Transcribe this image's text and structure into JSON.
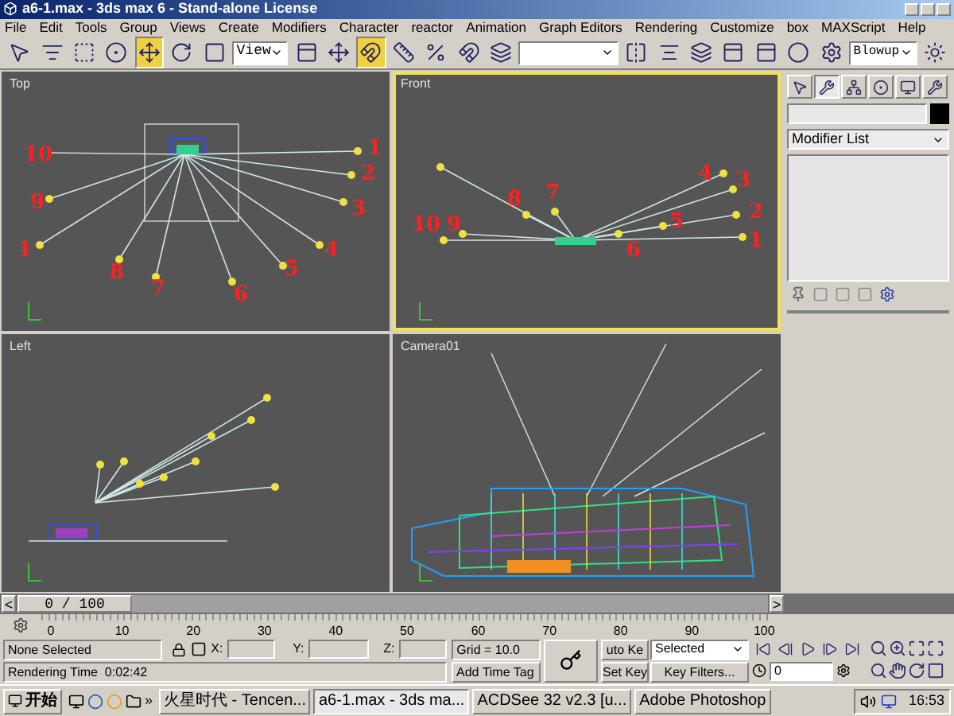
{
  "window": {
    "title": "a6-1.max - 3ds max 6 - Stand-alone License"
  },
  "menu": [
    "File",
    "Edit",
    "Tools",
    "Group",
    "Views",
    "Create",
    "Modifiers",
    "Character",
    "reactor",
    "Animation",
    "Graph Editors",
    "Rendering",
    "Customize",
    "box",
    "MAXScript",
    "Help"
  ],
  "toolbar": {
    "tools": [
      {
        "selected": false
      },
      {
        "selected": false
      },
      {
        "selected": false
      },
      {
        "selected": false
      },
      {
        "selected": true
      },
      {
        "selected": false
      },
      {
        "selected": false
      }
    ],
    "reference_coord": "View",
    "snaps": [
      {
        "selected": true
      },
      {
        "selected": false
      },
      {
        "selected": false
      },
      {
        "selected": false
      }
    ],
    "render_type": "Blowup"
  },
  "viewports": [
    {
      "label": "Top",
      "active": false,
      "annotations": [
        "10",
        "1",
        "2",
        "9",
        "3",
        "1",
        "4",
        "8",
        "5",
        "7",
        "6"
      ]
    },
    {
      "label": "Front",
      "active": true,
      "annotations": [
        "4",
        "3",
        "8",
        "7",
        "10",
        "9",
        "5",
        "2",
        "6",
        "1"
      ]
    },
    {
      "label": "Left",
      "active": false
    },
    {
      "label": "Camera01",
      "active": false
    }
  ],
  "command_panel": {
    "tabs": [
      {
        "selected": false
      },
      {
        "selected": true
      },
      {
        "selected": false
      },
      {
        "selected": false
      },
      {
        "selected": false
      },
      {
        "selected": false
      }
    ],
    "modifier_list": "Modifier List"
  },
  "time_slider": {
    "prev": "<",
    "position": "0 / 100",
    "next": ">",
    "level": 0
  },
  "track_ticks": [
    "0",
    "10",
    "20",
    "30",
    "40",
    "50",
    "60",
    "70",
    "80",
    "90",
    "100"
  ],
  "status": {
    "selection": "None Selected",
    "x_label": "X:",
    "y_label": "Y:",
    "z_label": "Z:",
    "grid": "Grid = 10.0",
    "prompt": "Rendering Time  0:02:42",
    "add_time_tag": "Add Time Tag"
  },
  "animation": {
    "auto_key": "uto Ke",
    "set_key": "Set Key",
    "key_mode": "Selected",
    "key_filters": "Key Filters...",
    "frame": "0"
  },
  "taskbar": {
    "start": "开始",
    "more": "»",
    "tasks": [
      {
        "label": "火星时代 - Tencen...",
        "selected": false
      },
      {
        "label": "a6-1.max - 3ds ma...",
        "selected": true
      },
      {
        "label": "ACDSee 32 v2.3 [u...",
        "selected": false
      },
      {
        "label": "Adobe Photoshop",
        "selected": false
      }
    ],
    "clock": "16:53"
  }
}
